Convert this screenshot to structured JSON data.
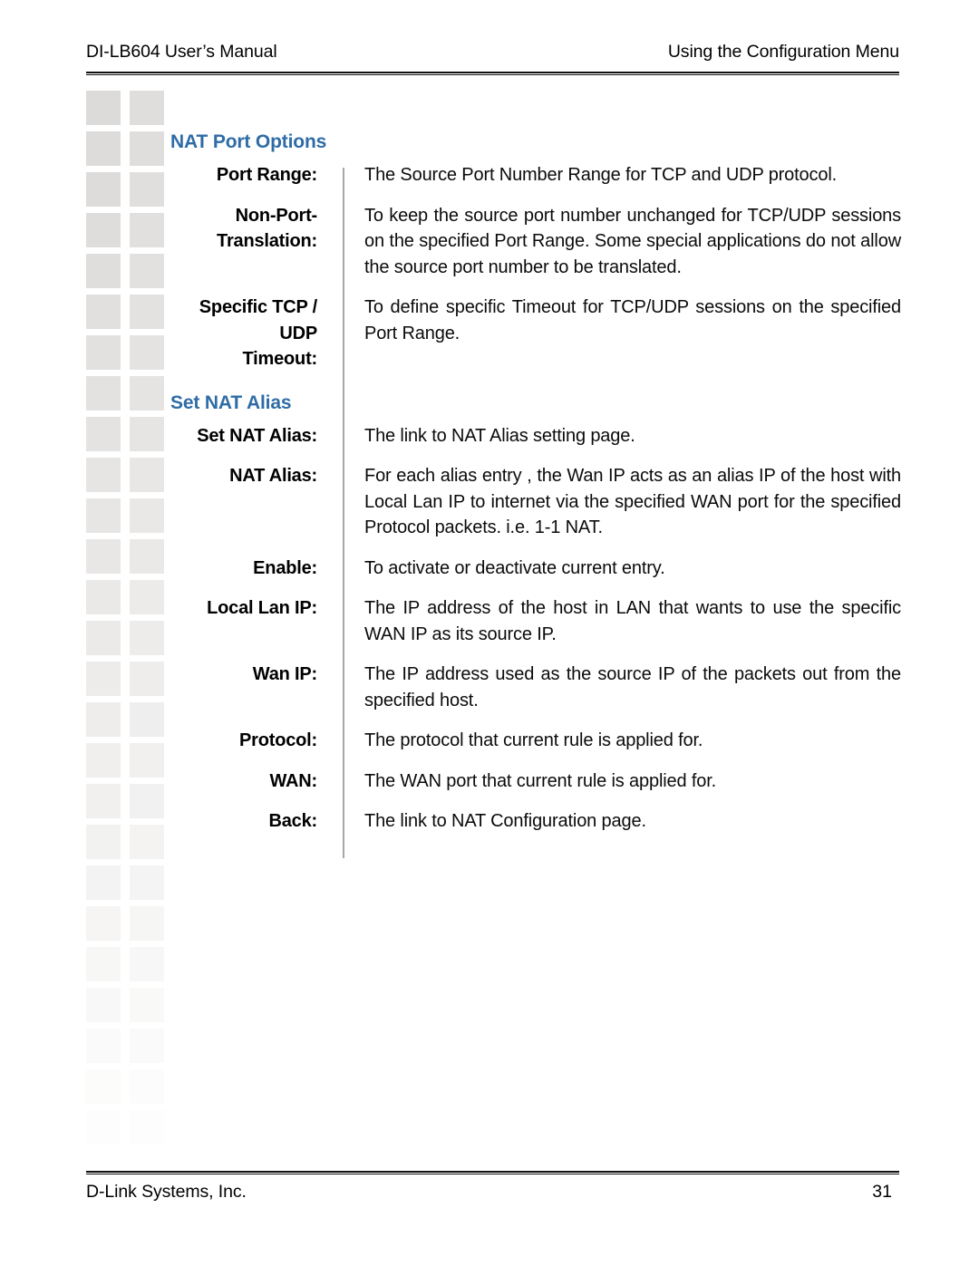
{
  "header": {
    "left": "DI-LB604 User’s Manual",
    "right": "Using the Configuration Menu"
  },
  "footer": {
    "company": "D-Link Systems, Inc.",
    "page_number": "31"
  },
  "colors": {
    "heading_blue": "#2f6ca6",
    "rule_black": "#111111",
    "divider_gray": "#a8a8a8",
    "deco_square": "#dddbd9"
  },
  "content": {
    "sections": [
      {
        "heading": "NAT Port Options",
        "rows": [
          {
            "label": "Port Range:",
            "description": "The Source Port Number Range for TCP and UDP protocol."
          },
          {
            "label": "Non-Port-\nTranslation:",
            "description": "To keep the source port number unchanged for TCP/UDP sessions on the specified Port Range. Some special applications do not allow the source port number to be translated."
          },
          {
            "label": "Specific TCP / UDP\nTimeout:",
            "description": "To define specific Timeout for TCP/UDP sessions on the specified Port Range."
          }
        ]
      },
      {
        "heading": "Set NAT Alias",
        "rows": [
          {
            "label": "Set NAT Alias:",
            "description": "The link to NAT Alias setting page."
          },
          {
            "label": "NAT Alias:",
            "description": "For each alias entry , the Wan IP acts as an alias IP of the host with Local Lan IP to internet via the specified WAN port for the specified Protocol packets. i.e. 1-1 NAT."
          },
          {
            "label": "Enable:",
            "description": "To activate or deactivate current entry."
          },
          {
            "label": "Local Lan IP:",
            "description": "The IP address of the host in LAN that wants to use the specific WAN IP as its source IP."
          },
          {
            "label": "Wan IP:",
            "description": "The IP address used as the source IP of the packets out from the specified host."
          },
          {
            "label": "Protocol:",
            "description": "The protocol that current rule is applied for."
          },
          {
            "label": "WAN:",
            "description": "The WAN port that current rule is applied for."
          },
          {
            "label": "Back:",
            "description": "The link to NAT Configuration page."
          }
        ]
      }
    ]
  }
}
